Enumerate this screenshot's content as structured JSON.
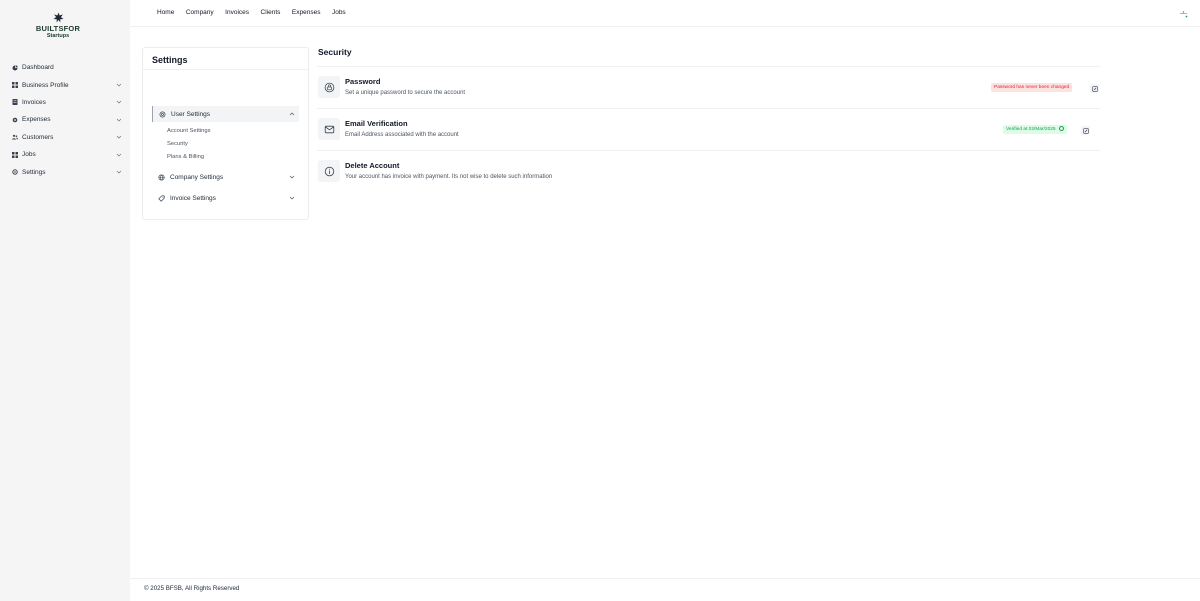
{
  "brand": {
    "line1": "BUILTSFOR",
    "line2": "Startups"
  },
  "sidebar": {
    "items": [
      {
        "label": "Dashboard",
        "icon": "dashboard-icon",
        "has_chevron": false
      },
      {
        "label": "Business Profile",
        "icon": "grid-icon",
        "has_chevron": true
      },
      {
        "label": "Invoices",
        "icon": "document-icon",
        "has_chevron": true
      },
      {
        "label": "Expenses",
        "icon": "gear-icon",
        "has_chevron": true
      },
      {
        "label": "Customers",
        "icon": "users-icon",
        "has_chevron": true
      },
      {
        "label": "Jobs",
        "icon": "grid-icon",
        "has_chevron": true
      },
      {
        "label": "Settings",
        "icon": "gear-icon",
        "has_chevron": true
      }
    ]
  },
  "topnav": {
    "items": [
      "Home",
      "Company",
      "Invoices",
      "Clients",
      "Expenses",
      "Jobs"
    ]
  },
  "settings": {
    "title": "Settings",
    "groups": [
      {
        "label": "User Settings",
        "icon": "gear-icon",
        "expanded": true,
        "subitems": [
          "Account Settings",
          "Security",
          "Plans & Billing"
        ]
      },
      {
        "label": "Company Settings",
        "icon": "globe-icon",
        "expanded": false
      },
      {
        "label": "Invoice Settings",
        "icon": "tag-icon",
        "expanded": false
      }
    ]
  },
  "security": {
    "title": "Security",
    "rows": [
      {
        "title": "Password",
        "description": "Set a unique password to secure the account",
        "icon": "lock-icon",
        "badge": "Password has never been changed",
        "badge_color": "#dc2626"
      },
      {
        "title": "Email Verification",
        "description": "Email Address associated with the account",
        "icon": "mail-icon",
        "badge": "Verified at 02/Mar/2025",
        "badge_color": "#16a34a"
      },
      {
        "title": "Delete Account",
        "description": "Your account has invoice with payment. Its not wise to delete such information",
        "icon": "info-icon"
      }
    ]
  },
  "footer": {
    "text": "© 2025 BFSB, All Rights Reserved"
  },
  "colors": {
    "brand": "#1e3a2f",
    "sidebar_bg": "#f5f5f5",
    "danger": "#dc2626",
    "success": "#16a34a"
  }
}
